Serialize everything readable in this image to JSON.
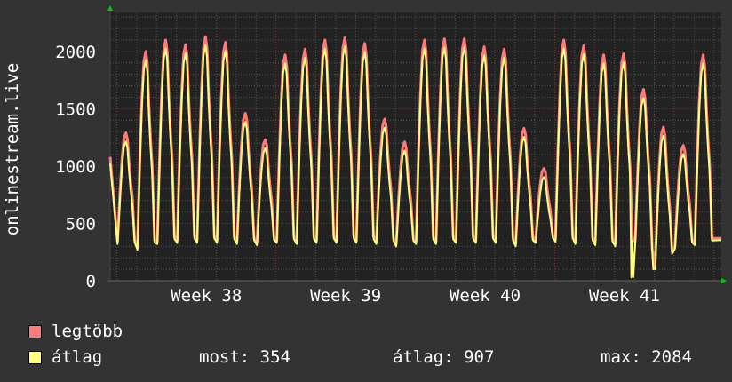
{
  "chart_data": {
    "type": "line",
    "ylabel": "onlinestream.live",
    "ylim": [
      0,
      2340
    ],
    "y_ticks": [
      "0",
      "500",
      "1000",
      "1500",
      "2000"
    ],
    "y_tick_values": [
      0,
      500,
      1000,
      1500,
      2000
    ],
    "x_unit": "days",
    "xlim": [
      -0.33,
      30.37
    ],
    "x_ticks": [
      {
        "label": "Week 38",
        "at": 4.5
      },
      {
        "label": "Week 39",
        "at": 11.5
      },
      {
        "label": "Week 40",
        "at": 18.5
      },
      {
        "label": "Week 41",
        "at": 25.5
      }
    ],
    "start_value": 1080,
    "daily_peaks_max": [
      1270,
      1980,
      2080,
      2040,
      2110,
      2060,
      1440,
      1210,
      1950,
      2000,
      2080,
      2100,
      2050,
      1390,
      1190,
      2080,
      2090,
      2090,
      2020,
      2000,
      1310,
      960,
      2080,
      2030,
      1950,
      1960,
      1650,
      1320,
      1160,
      1950
    ],
    "daily_troughs": [
      320,
      270,
      320,
      330,
      330,
      330,
      320,
      310,
      330,
      320,
      330,
      330,
      330,
      320,
      300,
      320,
      320,
      330,
      330,
      330,
      300,
      330,
      340,
      320,
      310,
      300,
      320,
      110,
      280,
      310
    ],
    "avg_dips": [
      {
        "day": 25.9,
        "value": 30
      },
      {
        "day": 27.0,
        "value": 100
      }
    ],
    "series": [
      {
        "name": "legtöbb",
        "color": "#ff7a7a"
      },
      {
        "name": "átlag",
        "color": "#ffff80"
      }
    ],
    "grid": true
  },
  "legend": {
    "max_label": "legtöbb",
    "avg_label": "átlag",
    "now_text": "most: 354",
    "avg_text": "átlag: 907",
    "max_text": "max: 2084"
  },
  "colors": {
    "max": "#ff7a7a",
    "avg": "#ffff80",
    "plot_bg": "#222222",
    "bg": "#333333"
  }
}
